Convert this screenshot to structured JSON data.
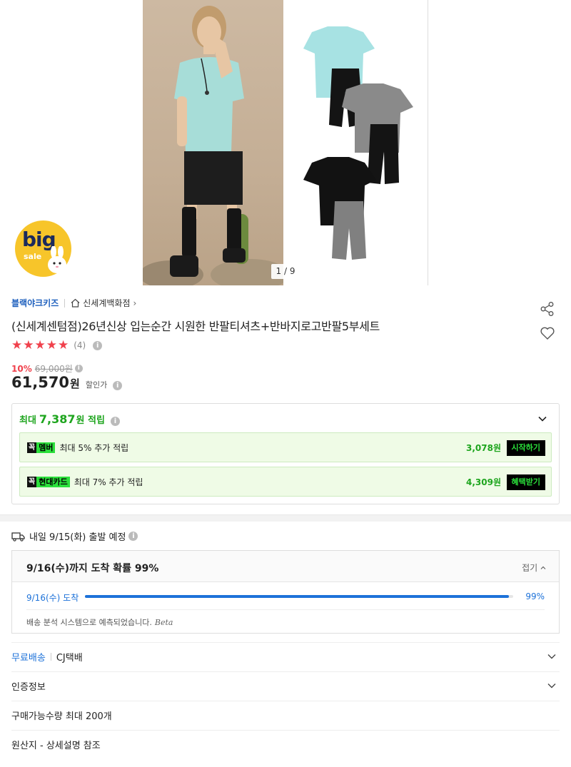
{
  "gallery": {
    "counter": "1 / 9",
    "badge_big": "big",
    "badge_sale": "sale"
  },
  "seller": {
    "brand": "블랙야크키즈",
    "store": "신세계백화점",
    "store_arrow": "›"
  },
  "product": {
    "title": "(신세계센텀점)26년신상 입는순간 시원한 반팔티셔츠+반바지로고반팔5부세트",
    "stars": "★★★★★",
    "rating": 5,
    "review_count": "(4)",
    "discount": "10%",
    "original_price": "69,000원",
    "price": "61,570",
    "price_unit": "원",
    "sale_label": "할인가"
  },
  "points": {
    "prefix": "최대",
    "amount": "7,387",
    "suffix": "원 적립",
    "rows": [
      {
        "tag_k": "꼭",
        "tag": "멤버",
        "text": "최대 5% 추가 적립",
        "amount": "3,078원",
        "button": "시작하기"
      },
      {
        "tag_k": "꼭",
        "tag": "현대카드",
        "text": "최대 7% 추가 적립",
        "amount": "4,309원",
        "button": "혜택받기"
      }
    ]
  },
  "shipping": {
    "depart": "내일 9/15(화) 출발 예정",
    "arrival_title": "9/16(수)까지 도착 확률 99%",
    "fold": "접기",
    "bar_label": "9/16(수) 도착",
    "bar_percent": "99%",
    "bar_value": 0.99,
    "note": "배송 분석 시스템으로 예측되었습니다.",
    "note_beta": "Beta"
  },
  "details": {
    "free_shipping": "무료배송",
    "courier": "CJ택배",
    "certification": "인증정보",
    "max_qty": "구매가능수량 최대 200개",
    "origin": "원산지 - 상세설명 참조"
  },
  "colors": {
    "accent_green": "#1ea51e",
    "tag_green": "#2be03b",
    "blue": "#1d72d9",
    "red": "#f0414c"
  }
}
